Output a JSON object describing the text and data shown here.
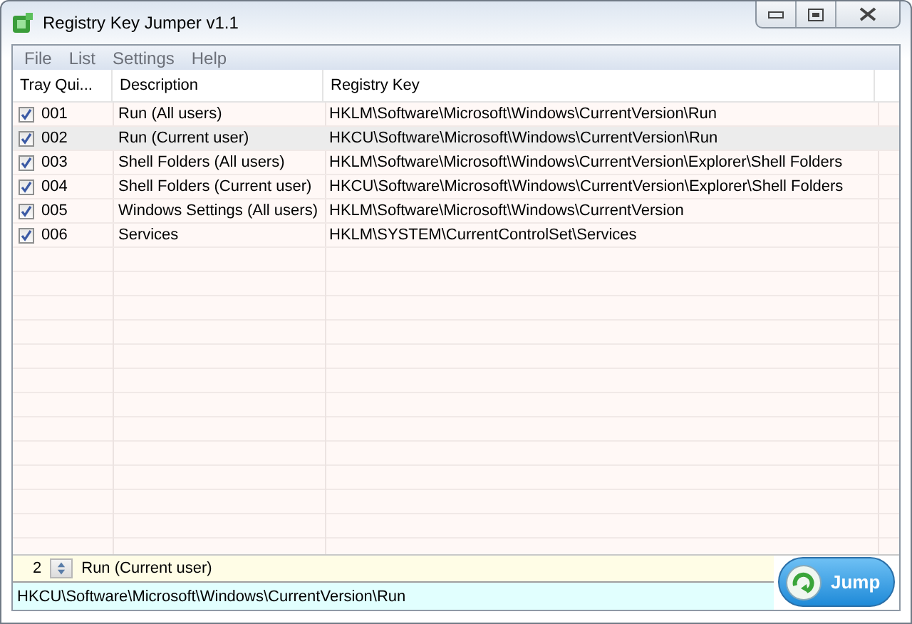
{
  "window": {
    "title": "Registry Key Jumper v1.1"
  },
  "menu": [
    "File",
    "List",
    "Settings",
    "Help"
  ],
  "table": {
    "columns": [
      "Tray Qui...",
      "Description",
      "Registry Key"
    ],
    "rows": [
      {
        "checked": true,
        "number": "001",
        "description": "Run (All users)",
        "key": "HKLM\\Software\\Microsoft\\Windows\\CurrentVersion\\Run",
        "selected": false
      },
      {
        "checked": true,
        "number": "002",
        "description": "Run (Current user)",
        "key": "HKCU\\Software\\Microsoft\\Windows\\CurrentVersion\\Run",
        "selected": true
      },
      {
        "checked": true,
        "number": "003",
        "description": "Shell Folders (All users)",
        "key": "HKLM\\Software\\Microsoft\\Windows\\CurrentVersion\\Explorer\\Shell Folders",
        "selected": false
      },
      {
        "checked": true,
        "number": "004",
        "description": "Shell Folders (Current user)",
        "key": "HKCU\\Software\\Microsoft\\Windows\\CurrentVersion\\Explorer\\Shell Folders",
        "selected": false
      },
      {
        "checked": true,
        "number": "005",
        "description": "Windows Settings (All users)",
        "key": "HKLM\\Software\\Microsoft\\Windows\\CurrentVersion",
        "selected": false
      },
      {
        "checked": true,
        "number": "006",
        "description": "Services",
        "key": "HKLM\\SYSTEM\\CurrentControlSet\\Services",
        "selected": false
      }
    ]
  },
  "selector": {
    "value": "2",
    "description": "Run (Current user)"
  },
  "path_field": {
    "value": "HKCU\\Software\\Microsoft\\Windows\\CurrentVersion\\Run"
  },
  "jump_button": {
    "label": "Jump"
  }
}
